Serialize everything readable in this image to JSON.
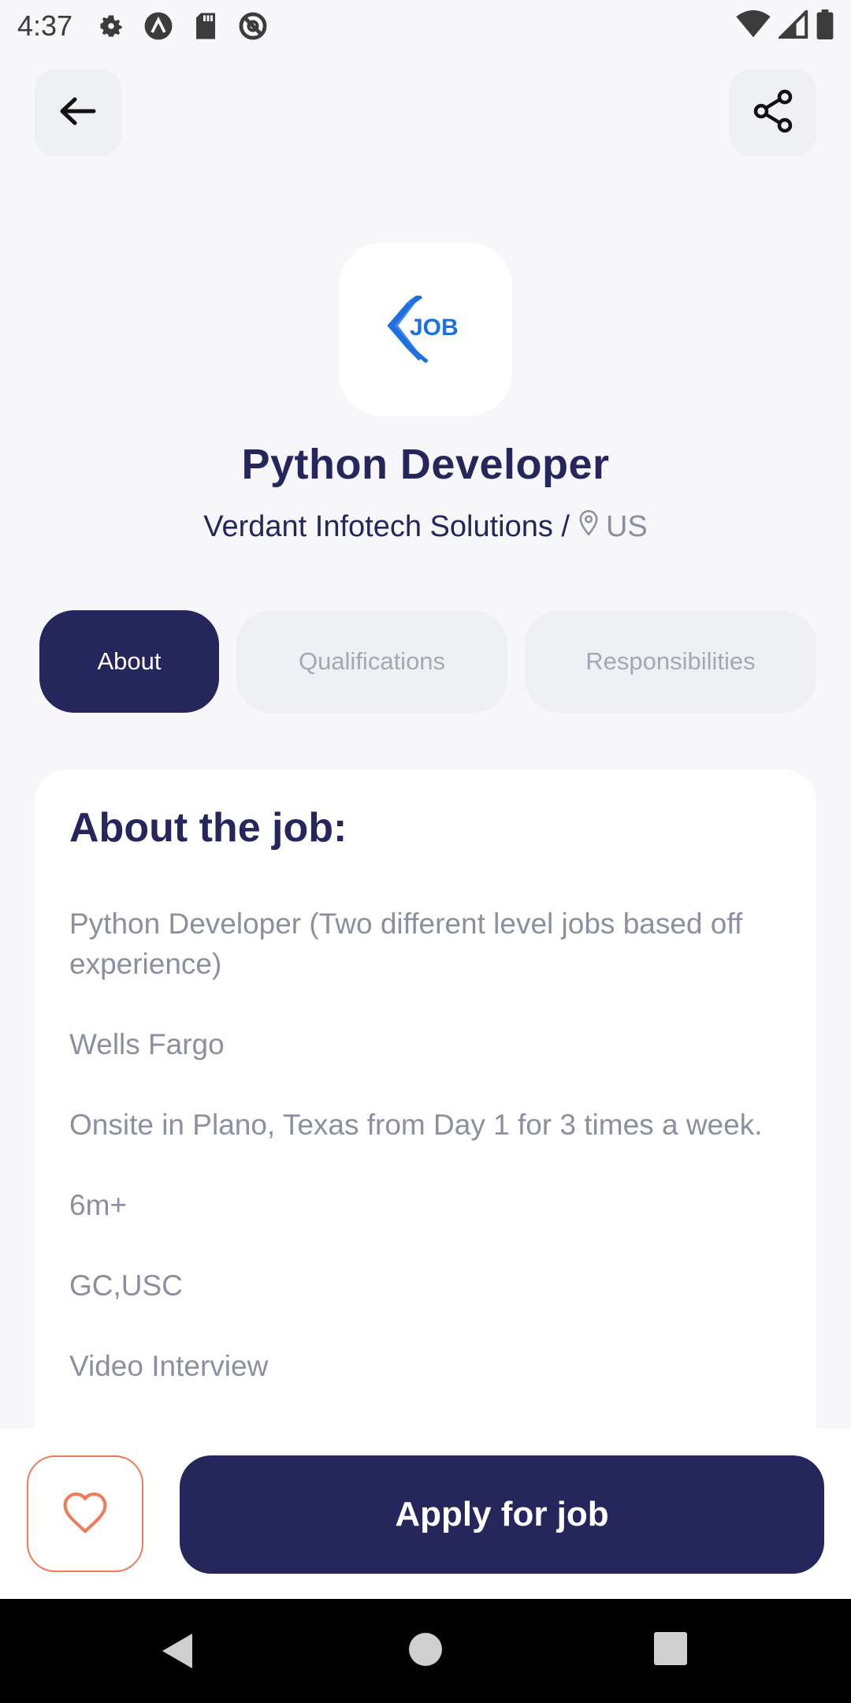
{
  "status_bar": {
    "time": "4:37",
    "icons": [
      "settings-gear-icon",
      "a-logo-icon",
      "sd-card-icon",
      "at-sign-icon"
    ],
    "right_icons": [
      "wifi-icon",
      "cell-signal-icon",
      "battery-icon"
    ]
  },
  "header": {
    "back_icon": "arrow-left-icon",
    "share_icon": "share-icon"
  },
  "company_logo": {
    "text": "JOB",
    "color": "#1e6fe0"
  },
  "job": {
    "title": "Python Developer",
    "company": "Verdant Infotech Solutions /",
    "location": "US"
  },
  "tabs": [
    {
      "label": "About",
      "active": true
    },
    {
      "label": "Qualifications",
      "active": false
    },
    {
      "label": "Responsibilities",
      "active": false
    }
  ],
  "about": {
    "heading": "About the job:",
    "paragraphs": [
      "Python Developer (Two different level jobs based off experience)",
      "Wells Fargo",
      "Onsite in Plano, Texas from Day 1 for 3 times a week.",
      "6m+",
      "GC,USC",
      "Video Interview"
    ]
  },
  "actions": {
    "favorite_icon": "heart-icon",
    "apply_label": "Apply for job"
  },
  "colors": {
    "primary": "#24265c",
    "accent": "#f07b56",
    "background": "#f7f7fa"
  }
}
